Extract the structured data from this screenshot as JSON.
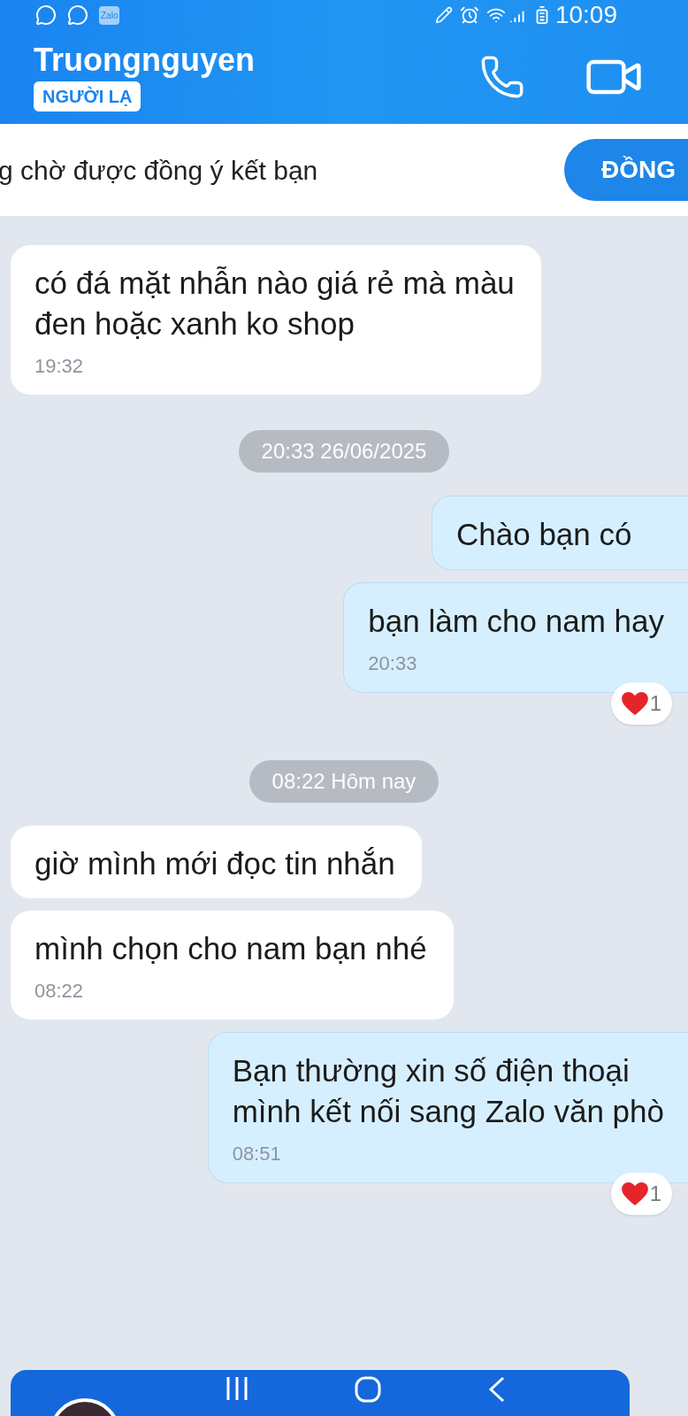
{
  "status_bar": {
    "notification_app": "Zalo",
    "time": "10:09"
  },
  "header": {
    "title": "Truongnguyen",
    "badge": "NGƯỜI LẠ"
  },
  "friend_request": {
    "text": "g chờ được đồng ý kết bạn",
    "button": "ĐỒNG"
  },
  "messages": [
    {
      "kind": "incoming",
      "lines": [
        "có đá mặt nhẫn nào giá rẻ mà màu",
        "đen hoặc xanh ko shop"
      ],
      "time": "19:32"
    },
    {
      "kind": "date",
      "text": "20:33 26/06/2025"
    },
    {
      "kind": "outgoing",
      "lines": [
        "Chào bạn có"
      ]
    },
    {
      "kind": "outgoing",
      "lines": [
        "bạn làm cho nam hay"
      ],
      "time": "20:33",
      "reaction_count": "1"
    },
    {
      "kind": "date",
      "text": "08:22 Hôm nay"
    },
    {
      "kind": "incoming",
      "lines": [
        "giờ mình mới đọc tin nhắn"
      ]
    },
    {
      "kind": "incoming",
      "lines": [
        "mình chọn cho nam bạn nhé"
      ],
      "time": "08:22"
    },
    {
      "kind": "outgoing",
      "lines": [
        "Bạn thường xin số điện thoại",
        "mình kết nối sang Zalo văn phò"
      ],
      "time": "08:51",
      "reaction_count": "1"
    }
  ]
}
